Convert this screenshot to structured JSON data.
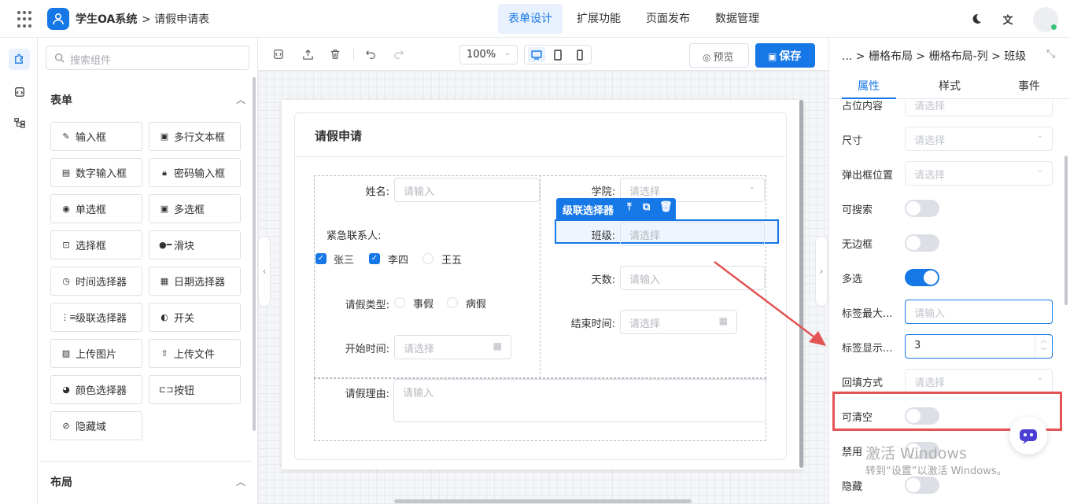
{
  "header": {
    "app_name": "学生OA系统",
    "breadcrumb": "> 请假申请表",
    "nav": [
      "表单设计",
      "扩展功能",
      "页面发布",
      "数据管理"
    ]
  },
  "panel": {
    "search_placeholder": "搜索组件",
    "section_form": "表单",
    "section_layout": "布局",
    "components": [
      "输入框",
      "多行文本框",
      "数字输入框",
      "密码输入框",
      "单选框",
      "多选框",
      "选择框",
      "滑块",
      "时间选择器",
      "日期选择器",
      "级联选择器",
      "开关",
      "上传图片",
      "上传文件",
      "颜色选择器",
      "按钮",
      "隐藏域"
    ]
  },
  "toolbar": {
    "zoom": "100%",
    "preview": "预览",
    "save": "保存"
  },
  "form": {
    "title": "请假申请",
    "name_label": "姓名:",
    "name_ph": "请输入",
    "college_label": "学院:",
    "college_ph": "请选择",
    "class_label": "班级:",
    "class_ph": "请选择",
    "contact_label": "紧急联系人:",
    "contacts": [
      "张三",
      "李四",
      "王五"
    ],
    "days_label": "天数:",
    "days_ph": "请输入",
    "type_label": "请假类型:",
    "types": [
      "事假",
      "病假"
    ],
    "end_label": "结束时间:",
    "end_ph": "请选择",
    "start_label": "开始时间:",
    "start_ph": "请选择",
    "reason_label": "请假理由:",
    "reason_ph": "请输入",
    "selected_widget": "级联选择器"
  },
  "props": {
    "path": "... > 栅格布局 > 栅格布局-列 > 班级",
    "tabs": [
      "属性",
      "样式",
      "事件"
    ],
    "rows": [
      {
        "label": "占位内容",
        "value": "请选择"
      },
      {
        "label": "尺寸",
        "value": "请选择"
      },
      {
        "label": "弹出框位置",
        "value": "请选择"
      },
      {
        "label": "可搜索"
      },
      {
        "label": "无边框"
      },
      {
        "label": "多选"
      },
      {
        "label": "标签最大...",
        "value": "请输入"
      },
      {
        "label": "标签显示...",
        "value": "3"
      },
      {
        "label": "回填方式",
        "value": "请选择"
      },
      {
        "label": "可清空"
      },
      {
        "label": "禁用"
      },
      {
        "label": "隐藏"
      }
    ]
  },
  "watermark": {
    "line1": "激活 Windows",
    "line2": "转到“设置”以激活 Windows。"
  },
  "colors": {
    "accent": "#1677e6",
    "highlight": "#e35454"
  }
}
